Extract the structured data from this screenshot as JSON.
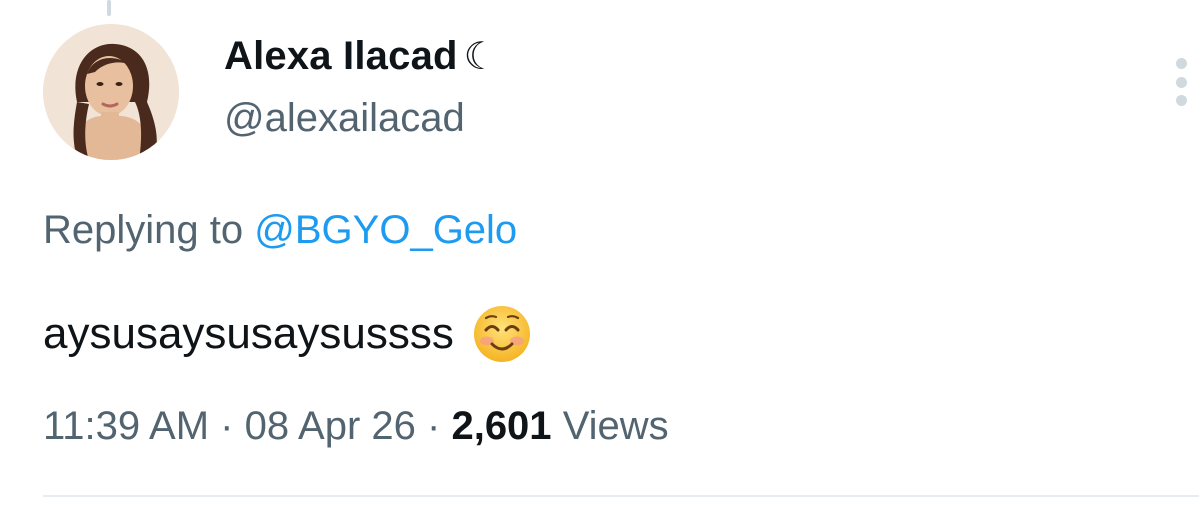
{
  "tweet": {
    "author": {
      "display_name": "Alexa Ilacad",
      "name_symbol": "☾",
      "handle": "@alexailacad"
    },
    "reply": {
      "prefix": "Replying to",
      "mention": "@BGYO_Gelo"
    },
    "text": "aysusaysusaysussss",
    "emoji": "smiling-face-with-smiling-eyes",
    "meta": {
      "time": "11:39 AM",
      "separator": "·",
      "date": "08 Apr 26",
      "views_count": "2,601",
      "views_label": "Views"
    }
  },
  "colors": {
    "primary_text": "#0f1419",
    "secondary_text": "#536471",
    "link": "#1d9bf0",
    "divider": "#e6ecf0"
  }
}
